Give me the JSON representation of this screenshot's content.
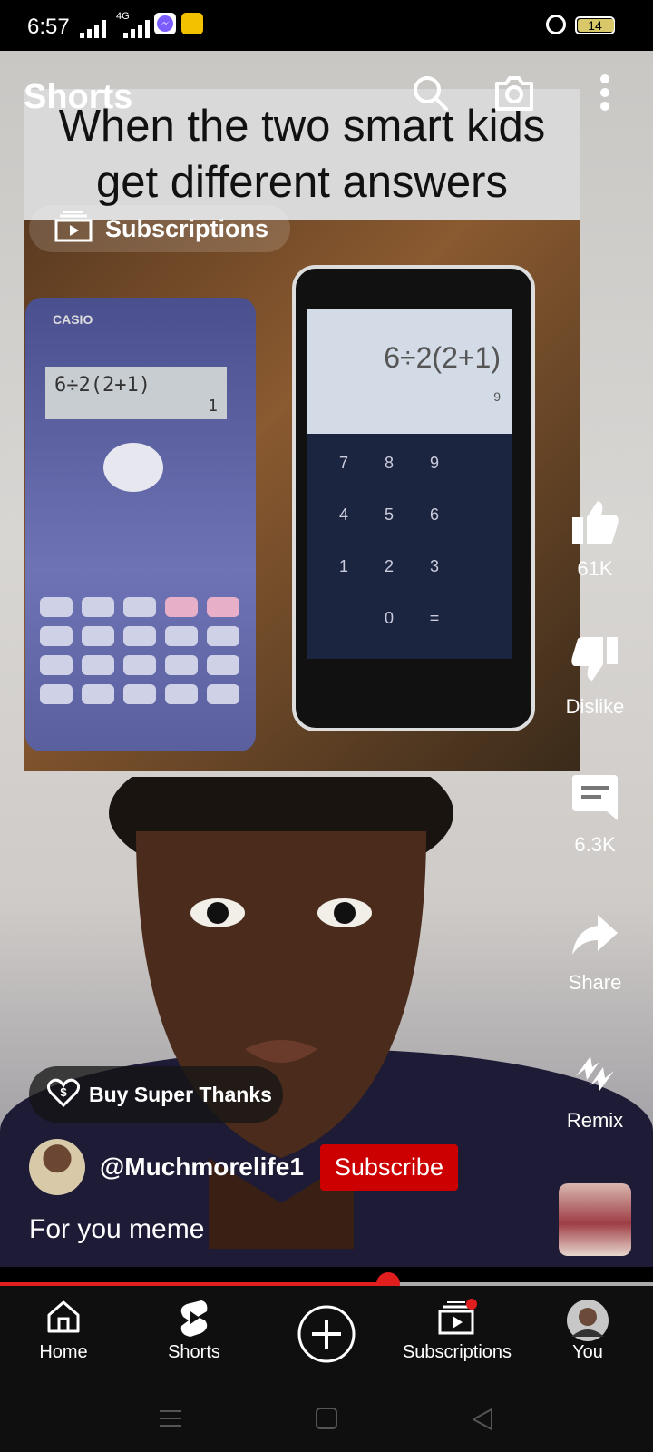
{
  "status_bar": {
    "time": "6:57",
    "network": "4G",
    "battery": "14"
  },
  "header": {
    "title": "Shorts",
    "search_icon": "search-icon",
    "camera_icon": "camera-icon",
    "more_icon": "more-vertical-icon"
  },
  "subscriptions_chip": {
    "label": "Subscriptions"
  },
  "video": {
    "meme_caption_line1": "When the two smart kids",
    "meme_caption_line2": "get different answers",
    "calculator_brand": "CASIO",
    "calculator_expression": "6÷2(2+1)",
    "calculator_result": "1",
    "phone_expression": "6÷2(2+1)",
    "phone_result": "9",
    "phone_keys": [
      "7",
      "8",
      "9",
      "4",
      "5",
      "6",
      "1",
      "2",
      "3",
      "",
      "0",
      "="
    ]
  },
  "actions": {
    "like_count": "61K",
    "dislike_label": "Dislike",
    "comment_count": "6.3K",
    "share_label": "Share",
    "remix_label": "Remix"
  },
  "super_thanks": {
    "label": "Buy Super Thanks"
  },
  "channel": {
    "handle": "@Muchmorelife1",
    "subscribe_label": "Subscribe"
  },
  "description": "For you meme",
  "progress": {
    "fraction": 0.594
  },
  "bottom_nav": {
    "items": [
      {
        "label": "Home",
        "icon": "home-icon"
      },
      {
        "label": "Shorts",
        "icon": "shorts-icon"
      },
      {
        "label": "",
        "icon": "create-icon"
      },
      {
        "label": "Subscriptions",
        "icon": "subscriptions-icon"
      },
      {
        "label": "You",
        "icon": "avatar"
      }
    ]
  },
  "colors": {
    "accent_red": "#cc0000",
    "progress_red": "#e01e1e",
    "nav_bg": "#0f0f0f"
  }
}
